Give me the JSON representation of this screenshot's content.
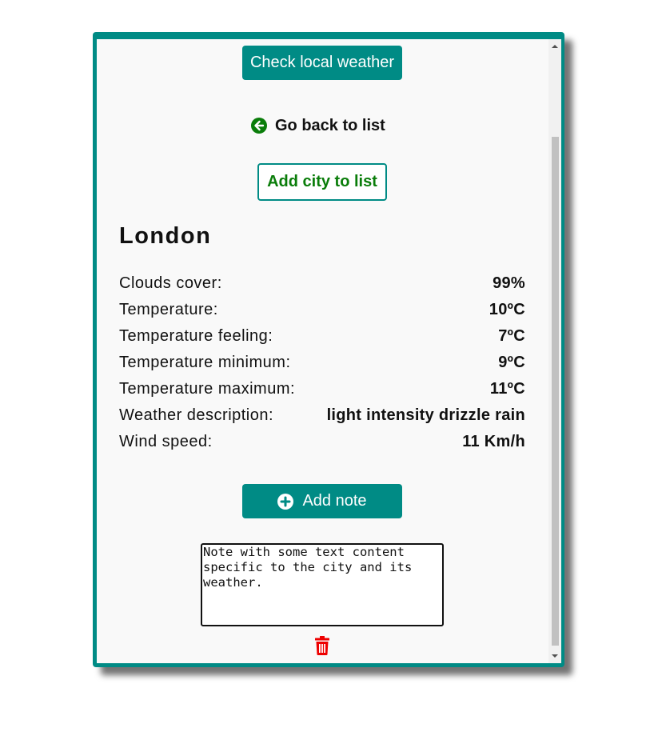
{
  "header": {
    "check_weather_label": "Check local weather",
    "back_label": "Go back to list",
    "add_city_label": "Add city to list"
  },
  "city": {
    "name": "London",
    "details": [
      {
        "label": "Clouds cover:",
        "value": "99%"
      },
      {
        "label": "Temperature:",
        "value": "10ºC"
      },
      {
        "label": "Temperature feeling:",
        "value": "7ºC"
      },
      {
        "label": "Temperature minimum:",
        "value": "9ºC"
      },
      {
        "label": "Temperature maximum:",
        "value": "11ºC"
      },
      {
        "label": "Weather description:",
        "value": "light intensity drizzle rain"
      },
      {
        "label": "Wind speed:",
        "value": "11 Km/h"
      }
    ]
  },
  "notes": {
    "add_note_label": "Add note",
    "note_text": "Note with some text content specific to the city and its weather."
  },
  "icons": {
    "back": "arrow-left-circle-icon",
    "add_note": "plus-circle-icon",
    "delete": "trash-icon"
  },
  "colors": {
    "teal": "#008b85",
    "green": "#0a7d0a",
    "delete_red": "#ee0000",
    "panel_background": "#f9f9f9"
  }
}
